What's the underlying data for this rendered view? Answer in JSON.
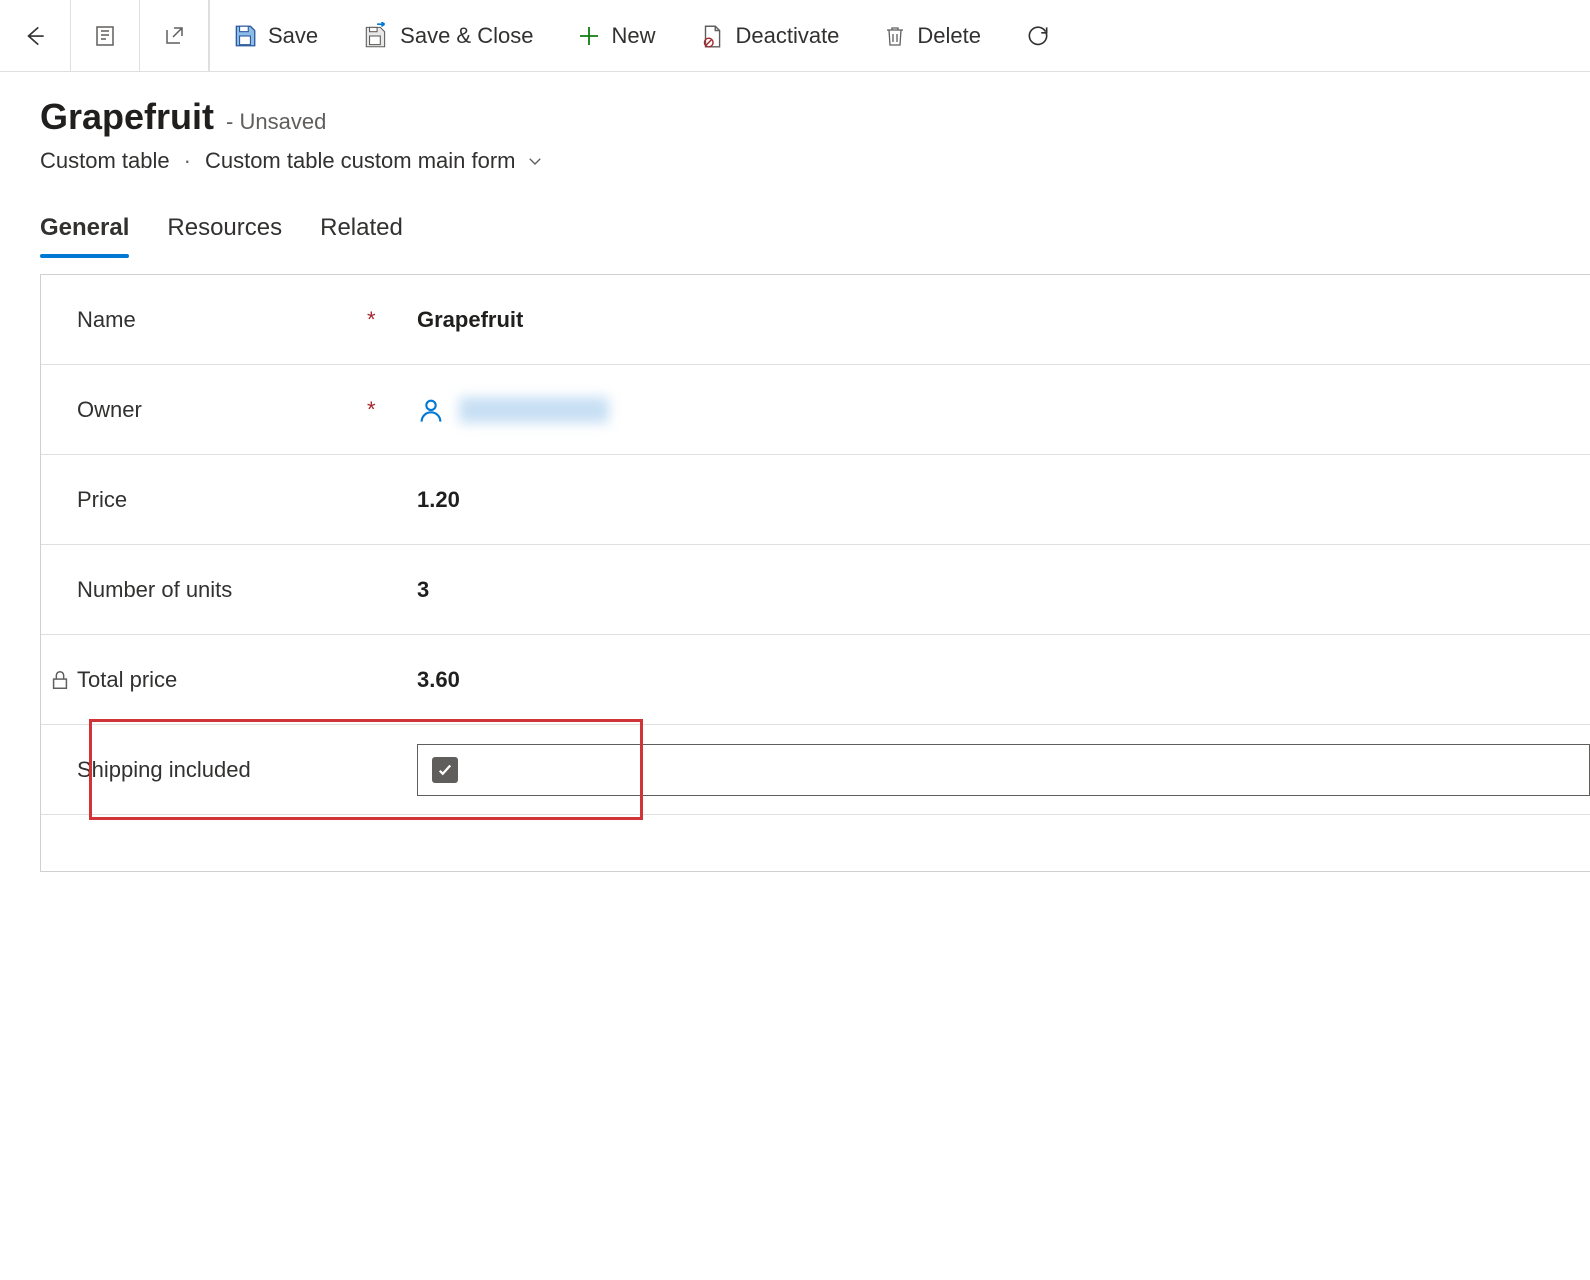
{
  "toolbar": {
    "save_label": "Save",
    "save_close_label": "Save & Close",
    "new_label": "New",
    "deactivate_label": "Deactivate",
    "delete_label": "Delete"
  },
  "header": {
    "title": "Grapefruit",
    "status": "- Unsaved",
    "entity": "Custom table",
    "form_name": "Custom table custom main form"
  },
  "tabs": [
    {
      "label": "General",
      "active": true
    },
    {
      "label": "Resources",
      "active": false
    },
    {
      "label": "Related",
      "active": false
    }
  ],
  "fields": {
    "name": {
      "label": "Name",
      "required": "*",
      "value": "Grapefruit"
    },
    "owner": {
      "label": "Owner",
      "required": "*"
    },
    "price": {
      "label": "Price",
      "value": "1.20"
    },
    "units": {
      "label": "Number of units",
      "value": "3"
    },
    "total": {
      "label": "Total price",
      "value": "3.60",
      "locked": true
    },
    "shipping": {
      "label": "Shipping included",
      "checked": true
    }
  }
}
